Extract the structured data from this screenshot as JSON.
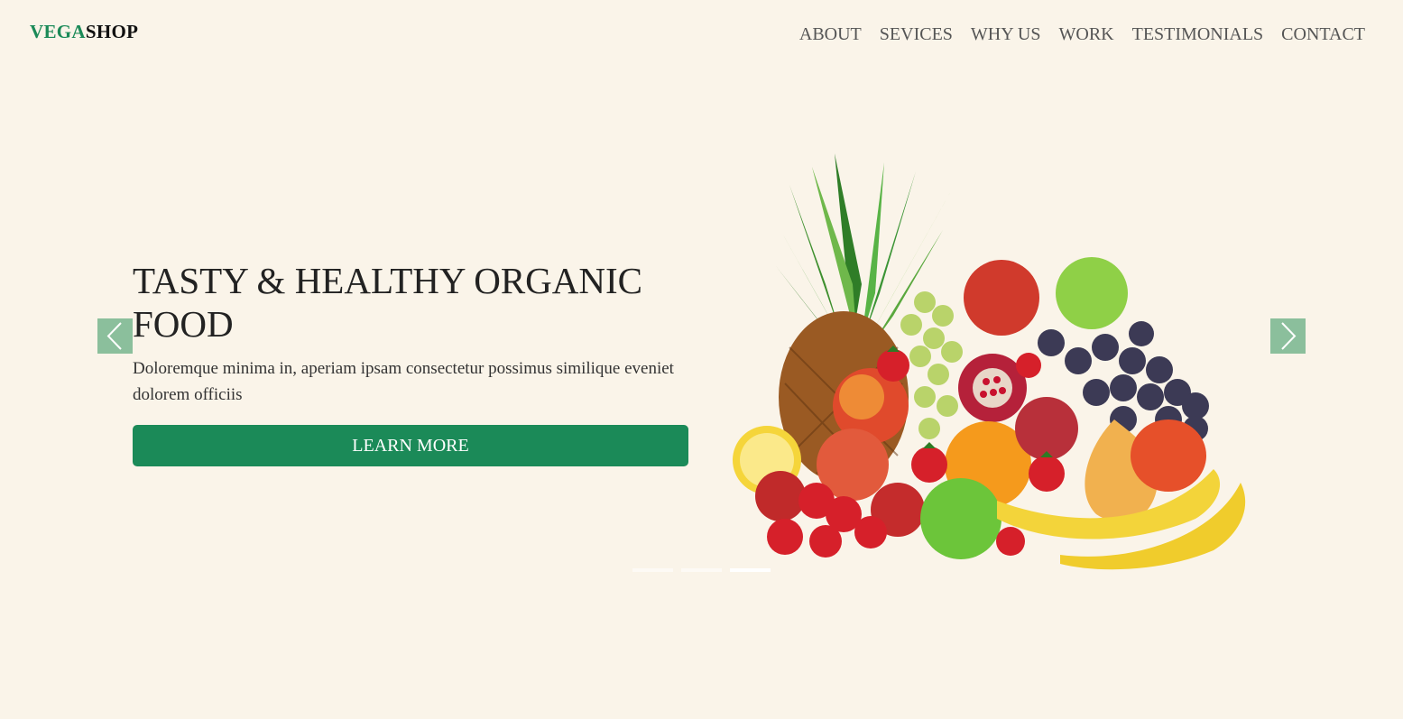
{
  "brand": {
    "part1": "VEGA",
    "part2": "SHOP"
  },
  "nav": {
    "items": [
      "ABOUT",
      "SEVICES",
      "WHY US",
      "WORK",
      "TESTIMONIALS",
      "CONTACT"
    ]
  },
  "hero": {
    "title": "TASTY & HEALTHY ORGANIC FOOD",
    "description": "Doloremque minima in, aperiam ipsam consectetur possimus similique eveniet dolorem officiis",
    "button": "LEARN MORE",
    "image_icon": "fruit-arrangement-image"
  },
  "carousel": {
    "slides": 3,
    "active_slide": 3,
    "prev_icon": "chevron-left-icon",
    "next_icon": "chevron-right-icon"
  },
  "colors": {
    "background": "#faf4e9",
    "accent": "#1b8a58",
    "arrow_bg": "#8bbf9c"
  }
}
